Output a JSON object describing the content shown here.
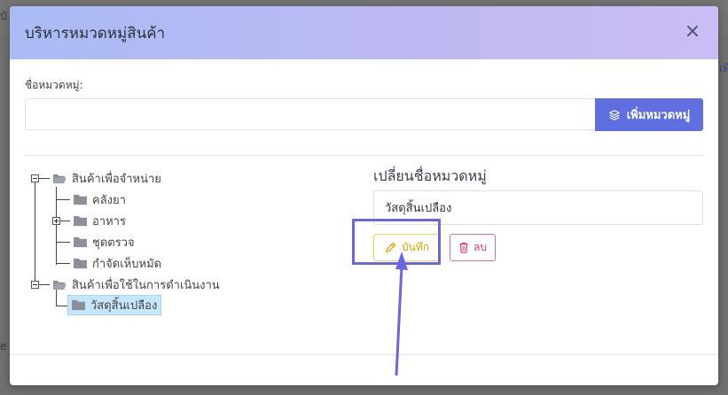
{
  "background": {
    "left_fragment": "บั",
    "right_fragment": "เพิ่",
    "bottom_left_fragment": "e H"
  },
  "modal": {
    "title": "บริหารหมวดหมู่สินค้า",
    "close_icon": "close-icon",
    "category_name_label": "ชื่อหมวดหมู่:",
    "category_name_value": "",
    "add_button_label": "เพิ่มหมวดหมู่",
    "add_button_icon": "layers-icon",
    "accent_color": "#5f6fe0"
  },
  "tree": {
    "roots": [
      {
        "label": "สินค้าเพื่อจำหน่าย",
        "expanded": true,
        "children": [
          {
            "label": "คลังยา",
            "expandable": false
          },
          {
            "label": "อาหาร",
            "expandable": true,
            "expanded": false
          },
          {
            "label": "ชุดตรวจ",
            "expandable": false
          },
          {
            "label": "กำจัดเห็บหมัด",
            "expandable": false
          }
        ]
      },
      {
        "label": "สินค้าเพื่อใช้ในการดำเนินงาน",
        "expanded": true,
        "children": [
          {
            "label": "วัสดุสิ้นเปลือง",
            "selected": true
          }
        ]
      }
    ]
  },
  "rename_panel": {
    "title": "เปลี่ยนชื่อหมวดหมู่",
    "input_value": "วัสดุสิ้นเปลือง",
    "save_label": "บันทึก",
    "save_icon": "pencil-icon",
    "delete_label": "ลบ",
    "delete_icon": "trash-icon",
    "save_color": "#d9a400",
    "delete_color": "#d63b75"
  },
  "annotation": {
    "highlight_color": "#6a66e0"
  }
}
